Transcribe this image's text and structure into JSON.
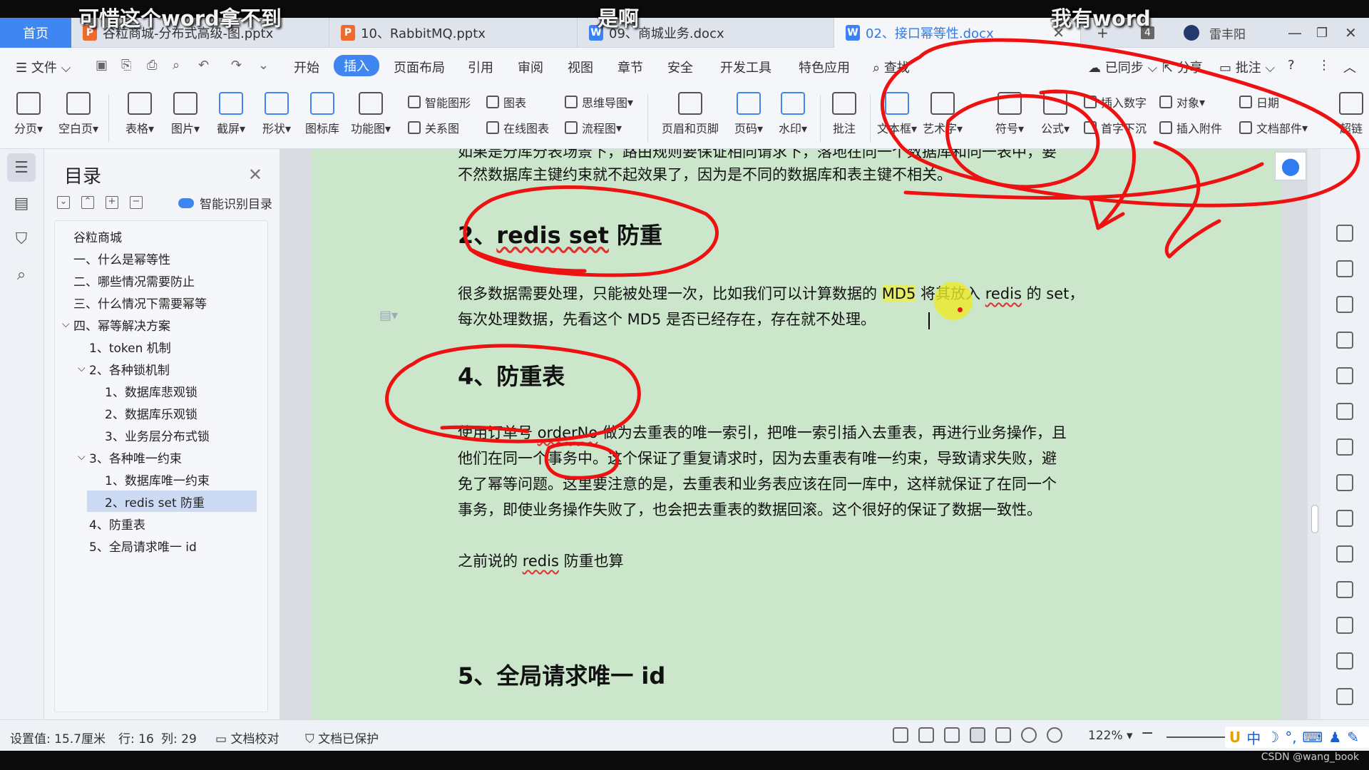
{
  "overlay": {
    "chat1": "可惜这个word拿不到",
    "chat2": "是啊",
    "chat3": "我有word"
  },
  "tabs": {
    "home": "首页",
    "t1": "谷粒商城-分布式高级-图.pptx",
    "t2": "10、RabbitMQ.pptx",
    "t3": "09、商城业务.docx",
    "t4": "02、接口幂等性.docx",
    "add": "+",
    "count": "4",
    "user": "雷丰阳"
  },
  "menu": {
    "file": "文件",
    "start": "开始",
    "insert": "插入",
    "layout": "页面布局",
    "reference": "引用",
    "review": "审阅",
    "view": "视图",
    "chapter": "章节",
    "security": "安全",
    "devtools": "开发工具",
    "special": "特色应用",
    "search": "查找",
    "synced": "已同步",
    "share": "分享",
    "comment": "批注",
    "help": "?"
  },
  "ribbon": {
    "page_break": "分页",
    "blank_page": "空白页",
    "table": "表格",
    "picture": "图片",
    "screenshot": "截屏",
    "shape": "形状",
    "icon_lib": "图标库",
    "func_chart": "功能图",
    "smart_shape": "智能图形",
    "chart": "图表",
    "mind_map": "思维导图",
    "relation": "关系图",
    "online_chart": "在线图表",
    "flowchart": "流程图",
    "header_footer": "页眉和页脚",
    "page_num": "页码",
    "watermark": "水印",
    "annotate": "批注",
    "textbox": "文本框",
    "art_text": "艺术字",
    "symbol": "符号",
    "formula": "公式",
    "insert_number": "插入数字",
    "object": "对象",
    "date": "日期",
    "drop_cap": "首字下沉",
    "attachment": "插入附件",
    "doc_parts": "文档部件",
    "hyperlink": "超链"
  },
  "toc": {
    "title": "目录",
    "ai": "智能识别目录",
    "items": [
      "谷粒商城",
      "一、什么是幂等性",
      "二、哪些情况需要防止",
      "三、什么情况下需要幂等",
      "四、幂等解决方案",
      "1、token 机制",
      "2、各种锁机制",
      "1、数据库悲观锁",
      "2、数据库乐观锁",
      "3、业务层分布式锁",
      "3、各种唯一约束",
      "1、数据库唯一约束",
      "2、redis set 防重",
      "4、防重表",
      "5、全局请求唯一 id"
    ]
  },
  "doc": {
    "top_line1": "如果是分库分表场景下，路由规则要保证相同请求下，落地在同一个数据库和同一表中，要",
    "top_line2": "不然数据库主键约束就不起效果了，因为是不同的数据库和表主键不相关。",
    "h_redis_num": "2、",
    "h_redis_main": "redis set",
    "h_redis_tail": " 防重",
    "p1_a": "很多数据需要处理，只能被处理一次，比如我们可以计算数据的 ",
    "p1_md5": "MD5",
    "p1_b": " 将其放入 ",
    "p1_redis": "redis",
    "p1_c": " 的 set，",
    "p1_line2": "每次处理数据，先看这个 MD5 是否已经存在，存在就不处理。",
    "h_table": "4、防重表",
    "p2_a": "使用订单号 ",
    "p2_order": "orderNo",
    "p2_b": " 做为去重表的唯一索引，把唯一索引插入去重表，再进行业务操作，且",
    "p2_line2": "他们在同一个事务中。这个保证了重复请求时，因为去重表有唯一约束，导致请求失败，避",
    "p2_line3": "免了幂等问题。这里要注意的是，去重表和业务表应该在同一库中，这样就保证了在同一个",
    "p2_line4": "事务，即使业务操作失败了，也会把去重表的数据回滚。这个很好的保证了数据一致性。",
    "p3_a": "之前说的 ",
    "p3_redis": "redis",
    "p3_b": " 防重也算",
    "h_global": "5、全局请求唯一 id"
  },
  "status": {
    "setting": "设置值: 15.7厘米",
    "row": "行: 16",
    "col": "列: 29",
    "proof": "文档校对",
    "protected": "文档已保护",
    "zoom": "122%",
    "ime_cn": "中",
    "watermark": "CSDN @wang_book"
  },
  "colors": {
    "accent": "#3f86f1",
    "page_bg": "#cbe6cb",
    "annotation": "#ee1111"
  }
}
